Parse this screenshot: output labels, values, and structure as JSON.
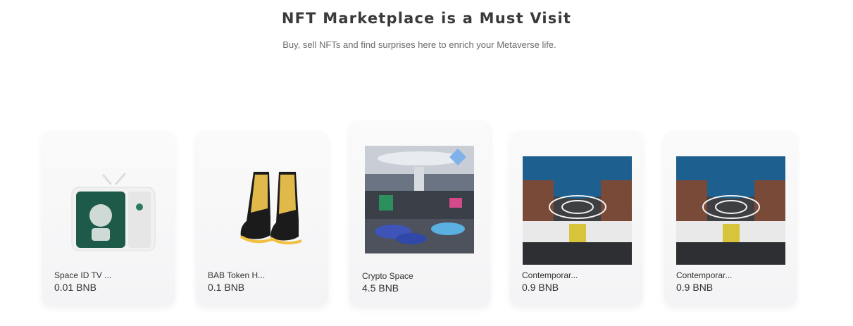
{
  "header": {
    "title": "NFT Marketplace is a Must Visit",
    "subtitle": "Buy, sell NFTs and find surprises here to enrich your Metaverse life."
  },
  "cards": [
    {
      "name": "Space ID TV ...",
      "price": "0.01 BNB",
      "image": "tv-icon"
    },
    {
      "name": "BAB Token H...",
      "price": "0.1 BNB",
      "image": "sneakers-image"
    },
    {
      "name": "Crypto Space",
      "price": "4.5 BNB",
      "image": "crypto-space-image"
    },
    {
      "name": "Contemporar...",
      "price": "0.9 BNB",
      "image": "gallery-image"
    },
    {
      "name": "Contemporar...",
      "price": "0.9 BNB",
      "image": "gallery-image"
    }
  ],
  "colors": {
    "title": "#3a3a3a",
    "subtitle": "#6b6b6b",
    "card_bg": "#f6f6f8"
  }
}
